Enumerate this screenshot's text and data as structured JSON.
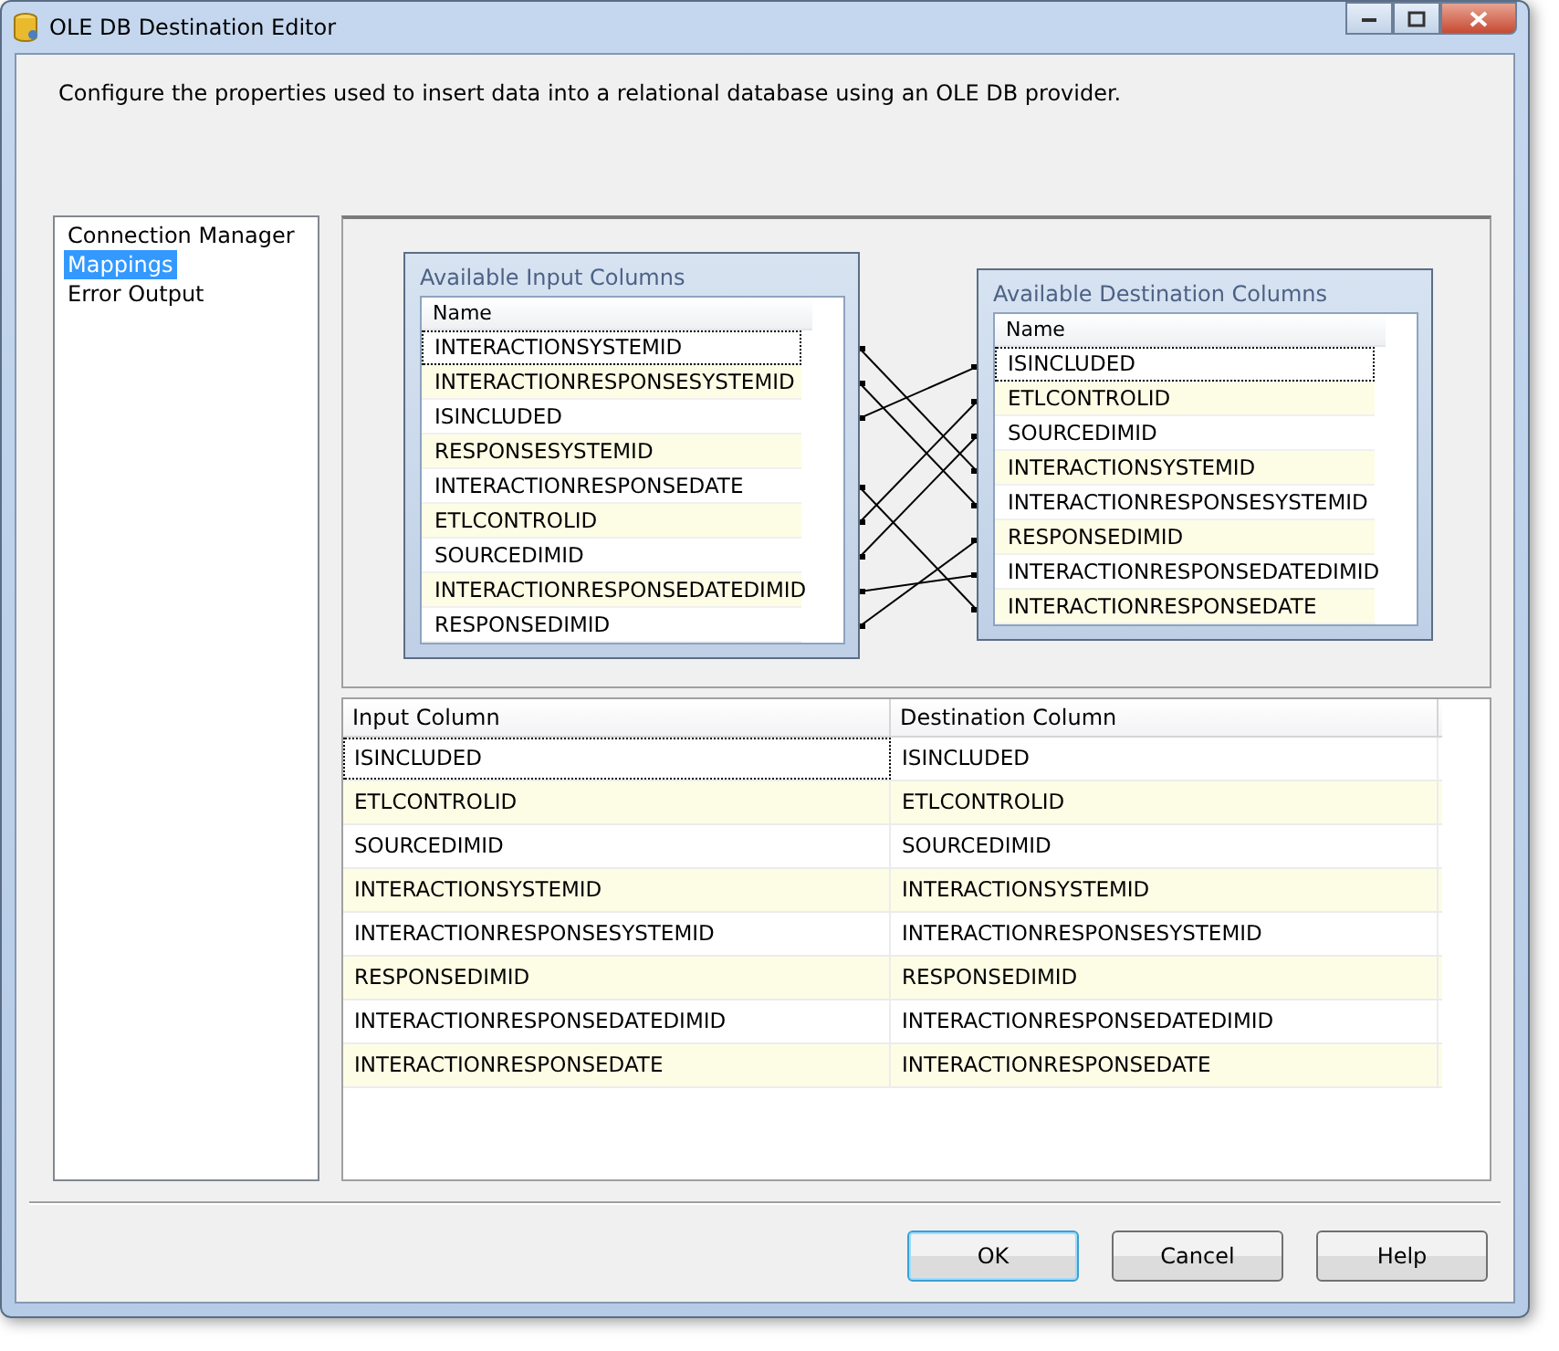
{
  "window": {
    "title": "OLE DB Destination Editor"
  },
  "description": "Configure the properties used to insert data into a relational database using an OLE DB provider.",
  "nav": [
    {
      "label": "Connection Manager",
      "selected": false
    },
    {
      "label": "Mappings",
      "selected": true
    },
    {
      "label": "Error Output",
      "selected": false
    }
  ],
  "input_columns": {
    "title": "Available Input Columns",
    "header": "Name",
    "items": [
      {
        "name": "INTERACTIONSYSTEMID",
        "focused": true
      },
      {
        "name": "INTERACTIONRESPONSESYSTEMID",
        "focused": false
      },
      {
        "name": "ISINCLUDED",
        "focused": false
      },
      {
        "name": "RESPONSESYSTEMID",
        "focused": false
      },
      {
        "name": "INTERACTIONRESPONSEDATE",
        "focused": false
      },
      {
        "name": "ETLCONTROLID",
        "focused": false
      },
      {
        "name": "SOURCEDIMID",
        "focused": false
      },
      {
        "name": "INTERACTIONRESPONSEDATEDIMID",
        "focused": false
      },
      {
        "name": "RESPONSEDIMID",
        "focused": false
      }
    ]
  },
  "destination_columns": {
    "title": "Available Destination Columns",
    "header": "Name",
    "items": [
      {
        "name": "ISINCLUDED",
        "focused": true
      },
      {
        "name": "ETLCONTROLID",
        "focused": false
      },
      {
        "name": "SOURCEDIMID",
        "focused": false
      },
      {
        "name": "INTERACTIONSYSTEMID",
        "focused": false
      },
      {
        "name": "INTERACTIONRESPONSESYSTEMID",
        "focused": false
      },
      {
        "name": "RESPONSEDIMID",
        "focused": false
      },
      {
        "name": "INTERACTIONRESPONSEDATEDIMID",
        "focused": false
      },
      {
        "name": "INTERACTIONRESPONSEDATE",
        "focused": false
      }
    ]
  },
  "mapping_table": {
    "columns": [
      "Input Column",
      "Destination Column"
    ],
    "rows": [
      {
        "input": "ISINCLUDED",
        "destination": "ISINCLUDED",
        "focused": true
      },
      {
        "input": "ETLCONTROLID",
        "destination": "ETLCONTROLID",
        "focused": false
      },
      {
        "input": "SOURCEDIMID",
        "destination": "SOURCEDIMID",
        "focused": false
      },
      {
        "input": "INTERACTIONSYSTEMID",
        "destination": "INTERACTIONSYSTEMID",
        "focused": false
      },
      {
        "input": "INTERACTIONRESPONSESYSTEMID",
        "destination": "INTERACTIONRESPONSESYSTEMID",
        "focused": false
      },
      {
        "input": "RESPONSEDIMID",
        "destination": "RESPONSEDIMID",
        "focused": false
      },
      {
        "input": "INTERACTIONRESPONSEDATEDIMID",
        "destination": "INTERACTIONRESPONSEDATEDIMID",
        "focused": false
      },
      {
        "input": "INTERACTIONRESPONSEDATE",
        "destination": "INTERACTIONRESPONSEDATE",
        "focused": false
      }
    ]
  },
  "buttons": [
    {
      "label": "OK",
      "default": true
    },
    {
      "label": "Cancel",
      "default": false
    },
    {
      "label": "Help",
      "default": false
    }
  ]
}
